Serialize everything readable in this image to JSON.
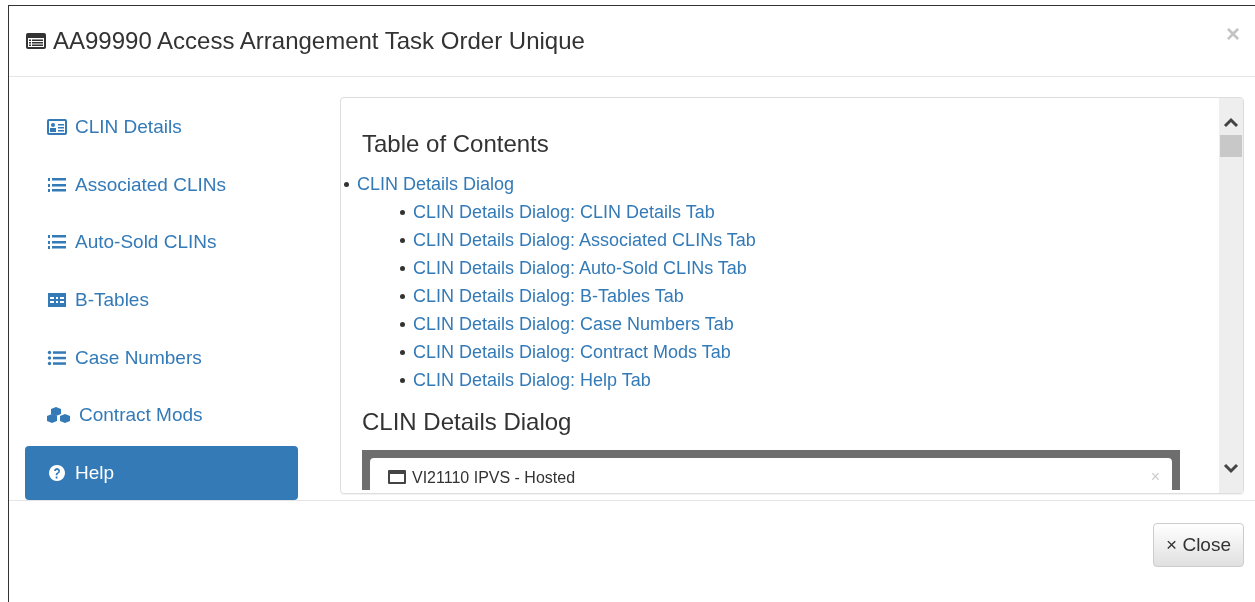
{
  "window": {
    "title": "AA99990 Access Arrangement Task Order Unique",
    "close": "×"
  },
  "sidebar": {
    "items": [
      {
        "label": "CLIN Details",
        "selected": false
      },
      {
        "label": "Associated CLINs",
        "selected": false
      },
      {
        "label": "Auto-Sold CLINs",
        "selected": false
      },
      {
        "label": "B-Tables",
        "selected": false
      },
      {
        "label": "Case Numbers",
        "selected": false
      },
      {
        "label": "Contract Mods",
        "selected": false
      },
      {
        "label": "Help",
        "selected": true
      }
    ]
  },
  "content": {
    "toc_heading": "Table of Contents",
    "toc": [
      {
        "label": "CLIN Details Dialog",
        "children": [
          {
            "label": "CLIN Details Dialog: CLIN Details Tab"
          },
          {
            "label": "CLIN Details Dialog: Associated CLINs Tab"
          },
          {
            "label": "CLIN Details Dialog: Auto-Sold CLINs Tab"
          },
          {
            "label": "CLIN Details Dialog: B-Tables Tab"
          },
          {
            "label": "CLIN Details Dialog: Case Numbers Tab"
          },
          {
            "label": "CLIN Details Dialog: Contract Mods Tab"
          },
          {
            "label": "CLIN Details Dialog: Help Tab"
          }
        ]
      }
    ],
    "section_heading": "CLIN Details Dialog",
    "embedded_screenshot": {
      "dialog_title": "VI21110 IPVS - Hosted",
      "close": "×"
    }
  },
  "footer": {
    "close_button": "× Close"
  }
}
